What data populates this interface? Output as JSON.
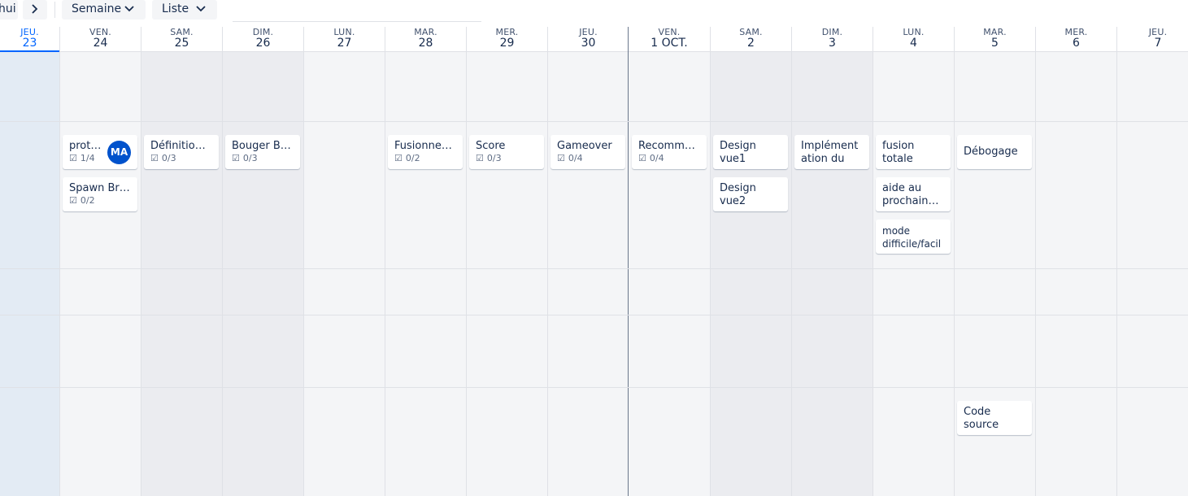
{
  "toolbar": {
    "today_label": "hui",
    "next_icon": "chevron-right-icon",
    "view_label": "Semaine",
    "mode_label": "Liste"
  },
  "columns": [
    {
      "dow": "JEU.",
      "num": "23"
    },
    {
      "dow": "VEN.",
      "num": "24"
    },
    {
      "dow": "SAM.",
      "num": "25"
    },
    {
      "dow": "DIM.",
      "num": "26"
    },
    {
      "dow": "LUN.",
      "num": "27"
    },
    {
      "dow": "MAR.",
      "num": "28"
    },
    {
      "dow": "MER.",
      "num": "29"
    },
    {
      "dow": "JEU.",
      "num": "30"
    },
    {
      "dow": "VEN.",
      "num": "1 OCT."
    },
    {
      "dow": "SAM.",
      "num": "2"
    },
    {
      "dow": "DIM.",
      "num": "3"
    },
    {
      "dow": "LUN.",
      "num": "4"
    },
    {
      "dow": "MAR.",
      "num": "5"
    },
    {
      "dow": "MER.",
      "num": "6"
    },
    {
      "dow": "JEU.",
      "num": "7"
    }
  ],
  "cards": {
    "c1": {
      "title": "prot…",
      "meta": "1/4",
      "avatar": "MA"
    },
    "c2": {
      "title": "Spawn Br…",
      "meta": "0/2"
    },
    "c3": {
      "title": "Définitio…",
      "meta": "0/3"
    },
    "c4": {
      "title": "Bouger B…",
      "meta": "0/3"
    },
    "c5": {
      "title": "Fusionne…",
      "meta": "0/2"
    },
    "c6": {
      "title": "Score",
      "meta": "0/3"
    },
    "c7": {
      "title": "Gameover",
      "meta": "0/4"
    },
    "c8": {
      "title": "Recomm…",
      "meta": "0/4"
    },
    "c9": {
      "title": "Design vue1"
    },
    "c10": {
      "title": "Design vue2"
    },
    "c11": {
      "title": "Implémentation du menu"
    },
    "c12": {
      "title": "fusion totale"
    },
    "c13": {
      "title": "aide au prochain…"
    },
    "c14": {
      "title": "mode difficile/facile"
    },
    "c15": {
      "title": "Débogage"
    },
    "c16": {
      "title": "Code source"
    }
  },
  "colors": {
    "accent": "#0065ff",
    "avatar": "#0052cc",
    "today_bg": "#e3ebf4",
    "weekend_bg": "#ebecf0"
  }
}
